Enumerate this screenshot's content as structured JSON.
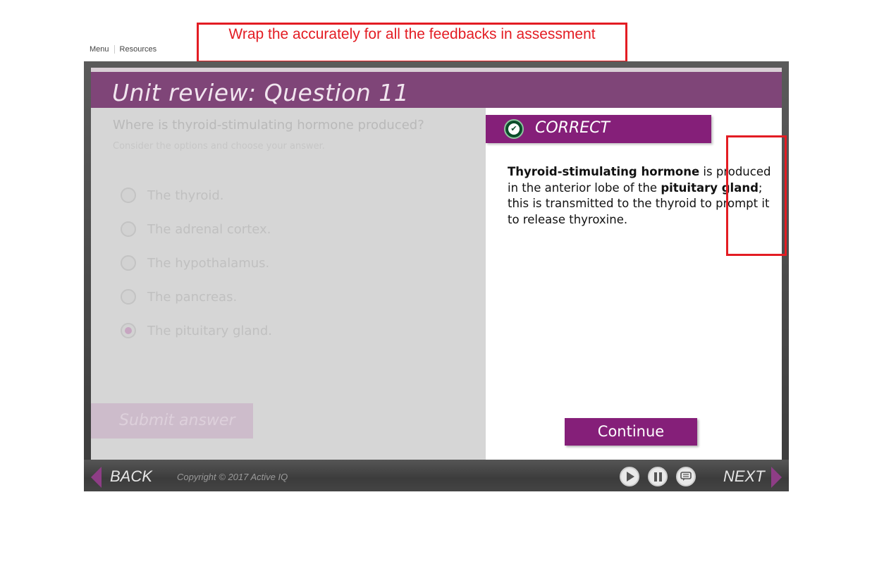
{
  "topnav": {
    "menu": "Menu",
    "resources": "Resources"
  },
  "annotation": {
    "text": "Wrap the accurately for all the feedbacks in assessment"
  },
  "header": {
    "title": "Unit review: Question 11"
  },
  "question": {
    "prompt": "Where is thyroid-stimulating hormone produced?",
    "instruction": "Consider the options and choose your answer.",
    "options": [
      {
        "label": "The thyroid.",
        "selected": false
      },
      {
        "label": "The adrenal cortex.",
        "selected": false
      },
      {
        "label": "The hypothalamus.",
        "selected": false
      },
      {
        "label": "The pancreas.",
        "selected": false
      },
      {
        "label": "The pituitary gland.",
        "selected": true
      }
    ],
    "submit_label": "Submit answer"
  },
  "feedback": {
    "status": "CORRECT",
    "text_bold_1": "Thyroid-stimulating hormone",
    "text_1": " is produced in the anterior lobe of the ",
    "text_bold_2": "pituitary gland",
    "text_2": "; this is transmitted to the thyroid to prompt it to release thyroxine.",
    "continue_label": "Continue"
  },
  "footer": {
    "back_label": "BACK",
    "copyright": "Copyright © 2017 Active IQ",
    "next_label": "NEXT"
  },
  "icons": {
    "check": "check-circle-icon",
    "play": "play-icon",
    "pause": "pause-icon",
    "captions": "captions-icon"
  },
  "colors": {
    "accent": "#851f79",
    "title_bar": "#7f4578",
    "callout": "#e31c23",
    "correct_badge": "#0b4d2a"
  }
}
